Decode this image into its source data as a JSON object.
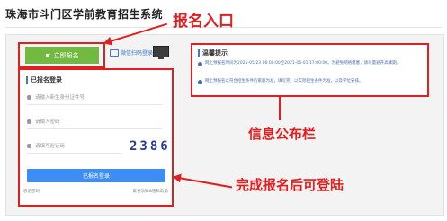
{
  "page": {
    "title": "珠海市斗门区学前教育招生系统"
  },
  "annotations": {
    "register_entry": "报名入口",
    "notice_board": "信息公布栏",
    "login_after": "完成报名后可登陆"
  },
  "actions": {
    "register_button": "立即报名",
    "wechat_login": "微信扫码登录"
  },
  "login": {
    "section_title": "已报名登录",
    "id_placeholder": "请输入新生身份证件号",
    "password_placeholder": "请输入密码",
    "captcha_placeholder": "请填写验证码",
    "captcha_code": "2386",
    "login_button": "已报名登录",
    "forgot_password": "忘记密码",
    "right_link": "家长须知&隐私政策"
  },
  "notice": {
    "title": "温馨提示",
    "items": [
      "网上预报名时间为2021-05-23 06:00:00至2021-06-01 17:00:00。为避免网络堵塞，请尽量避开高峰期。",
      "网上预报名以符合招生条件的家庭为准，填写完，以实际招生条件为准，以及学位安排。"
    ]
  },
  "colors": {
    "accent_red": "#e02020",
    "register_green": "#71b940",
    "login_blue": "#3d8df5"
  }
}
